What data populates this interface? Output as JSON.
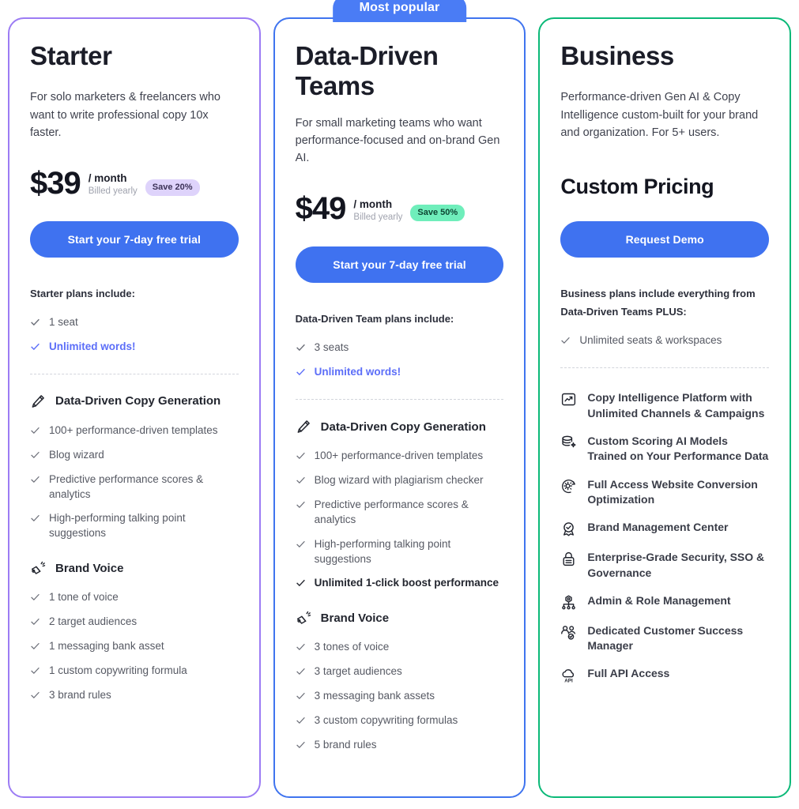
{
  "plans": [
    {
      "id": "starter",
      "accent_color": "#9c7cf4",
      "name": "Starter",
      "description": "For solo marketers & freelancers who want to write professional copy 10x faster.",
      "price": "$39",
      "period": "/ month",
      "billed": "Billed yearly",
      "save_badge": "Save 20%",
      "cta_label": "Start your 7-day free trial",
      "includes_title": "Starter plans include:",
      "includes": [
        {
          "label": "1 seat",
          "style": "normal"
        },
        {
          "label": "Unlimited words!",
          "style": "highlight"
        }
      ],
      "groups": [
        {
          "icon": "pencil-icon",
          "title": "Data-Driven Copy Generation",
          "items": [
            {
              "label": "100+ performance-driven templates",
              "style": "normal"
            },
            {
              "label": "Blog wizard",
              "style": "normal"
            },
            {
              "label": "Predictive performance scores & analytics",
              "style": "normal"
            },
            {
              "label": "High-performing talking point suggestions",
              "style": "normal"
            }
          ]
        },
        {
          "icon": "megaphone-icon",
          "title": "Brand Voice",
          "items": [
            {
              "label": "1 tone of voice",
              "style": "normal"
            },
            {
              "label": "2 target audiences",
              "style": "normal"
            },
            {
              "label": "1 messaging bank asset",
              "style": "normal"
            },
            {
              "label": "1 custom copywriting formula",
              "style": "normal"
            },
            {
              "label": "3 brand rules",
              "style": "normal"
            }
          ]
        }
      ]
    },
    {
      "id": "teams",
      "accent_color": "#3f74ef",
      "ribbon": "Most popular",
      "name": "Data-Driven Teams",
      "description": "For small marketing teams who want performance-focused and on-brand Gen AI.",
      "price": "$49",
      "period": "/ month",
      "billed": "Billed yearly",
      "save_badge": "Save 50%",
      "cta_label": "Start your 7-day free trial",
      "includes_title": "Data-Driven Team plans include:",
      "includes": [
        {
          "label": "3 seats",
          "style": "normal"
        },
        {
          "label": "Unlimited words!",
          "style": "highlight"
        }
      ],
      "groups": [
        {
          "icon": "pencil-icon",
          "title": "Data-Driven Copy Generation",
          "items": [
            {
              "label": "100+ performance-driven templates",
              "style": "normal"
            },
            {
              "label": "Blog wizard with plagiarism checker",
              "style": "normal"
            },
            {
              "label": "Predictive performance scores & analytics",
              "style": "normal"
            },
            {
              "label": "High-performing talking point suggestions",
              "style": "normal"
            },
            {
              "label": "Unlimited 1-click boost performance",
              "style": "bold"
            }
          ]
        },
        {
          "icon": "megaphone-icon",
          "title": "Brand Voice",
          "items": [
            {
              "label": "3 tones of voice",
              "style": "normal"
            },
            {
              "label": "3 target audiences",
              "style": "normal"
            },
            {
              "label": "3 messaging bank assets",
              "style": "normal"
            },
            {
              "label": "3 custom copywriting formulas",
              "style": "normal"
            },
            {
              "label": "5 brand rules",
              "style": "normal"
            }
          ]
        }
      ]
    },
    {
      "id": "business",
      "accent_color": "#0bb978",
      "name": "Business",
      "description": "Performance-driven Gen AI & Copy Intelligence custom-built for your brand and organization. For 5+ users.",
      "custom_pricing": "Custom Pricing",
      "cta_label": "Request Demo",
      "includes_title": "Business plans include everything from Data-Driven Teams PLUS:",
      "includes": [
        {
          "label": "Unlimited seats & workspaces",
          "style": "normal"
        }
      ],
      "feature_rows": [
        {
          "icon": "chart-box-icon",
          "label": "Copy Intelligence Platform with Unlimited Channels & Campaigns"
        },
        {
          "icon": "database-sparkle-icon",
          "label": "Custom Scoring AI Models Trained on Your Performance Data"
        },
        {
          "icon": "gear-optimize-icon",
          "label": "Full Access Website Conversion Optimization"
        },
        {
          "icon": "badge-check-icon",
          "label": "Brand Management Center"
        },
        {
          "icon": "lock-icon",
          "label": "Enterprise-Grade Security, SSO & Governance"
        },
        {
          "icon": "org-chart-icon",
          "label": "Admin & Role Management"
        },
        {
          "icon": "users-check-icon",
          "label": "Dedicated Customer Success Manager"
        },
        {
          "icon": "cloud-api-icon",
          "label": "Full API Access"
        }
      ]
    }
  ],
  "colors": {
    "cta_blue": "#3f72f0",
    "ribbon_blue": "#4a7cf5",
    "starter_border": "#9c7cf4",
    "teams_border": "#3f74ef",
    "business_border": "#0bb978",
    "highlight_text": "#5c6ef8",
    "save_purple_bg": "#ded3fb",
    "save_green_bg": "#6feebb"
  }
}
